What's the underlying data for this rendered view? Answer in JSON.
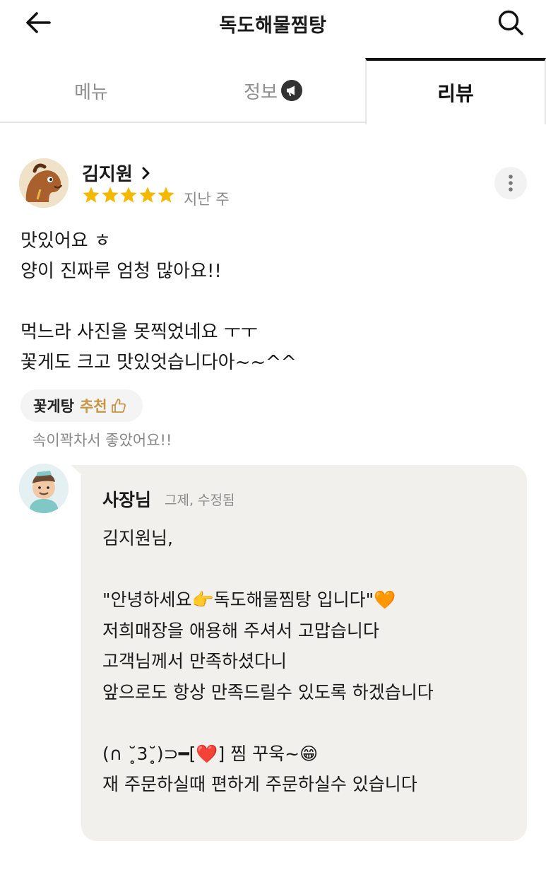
{
  "header": {
    "title": "독도해물찜탕",
    "back_icon": "arrow-left-icon",
    "search_icon": "search-icon"
  },
  "tabs": [
    {
      "label": "메뉴",
      "active": false
    },
    {
      "label": "정보",
      "active": false,
      "icon": "megaphone-icon"
    },
    {
      "label": "리뷰",
      "active": true
    }
  ],
  "review": {
    "reviewer_name": "김지원",
    "rating": 5,
    "date": "지난 주",
    "lines": [
      "맛있어요 ㅎ",
      "양이 진짜루 엄청 많아요!!",
      "",
      "먹느라 사진을 못찍었네요 ㅜㅜ",
      "꽃게도 크고 맛있엇습니다아~~^^"
    ],
    "recommended_menu": "꽃게탕",
    "recommend_label": "추천",
    "recommend_comment": "속이꽉차서 좋았어요!!"
  },
  "owner_reply": {
    "name": "사장님",
    "meta": "그제, 수정됨",
    "lines": [
      "김지원님,",
      "",
      "\"안녕하세요👉독도해물찜탕 입니다\"🧡",
      "저희매장을 애용해 주셔서 고맙습니다",
      "고객님께서 만족하셨다니",
      "앞으로도 항상 만족드릴수 있도록 하겠습니다",
      "",
      "(∩ ˘̥3˘̥)⊃━[❤️] 찜 꾸욱~😁",
      "재 주문하실때 편하게 주문하실수 있습니다"
    ]
  },
  "colors": {
    "star": "#f5b800",
    "recommend": "#c79444",
    "reply_bg": "#f2f0ec"
  }
}
